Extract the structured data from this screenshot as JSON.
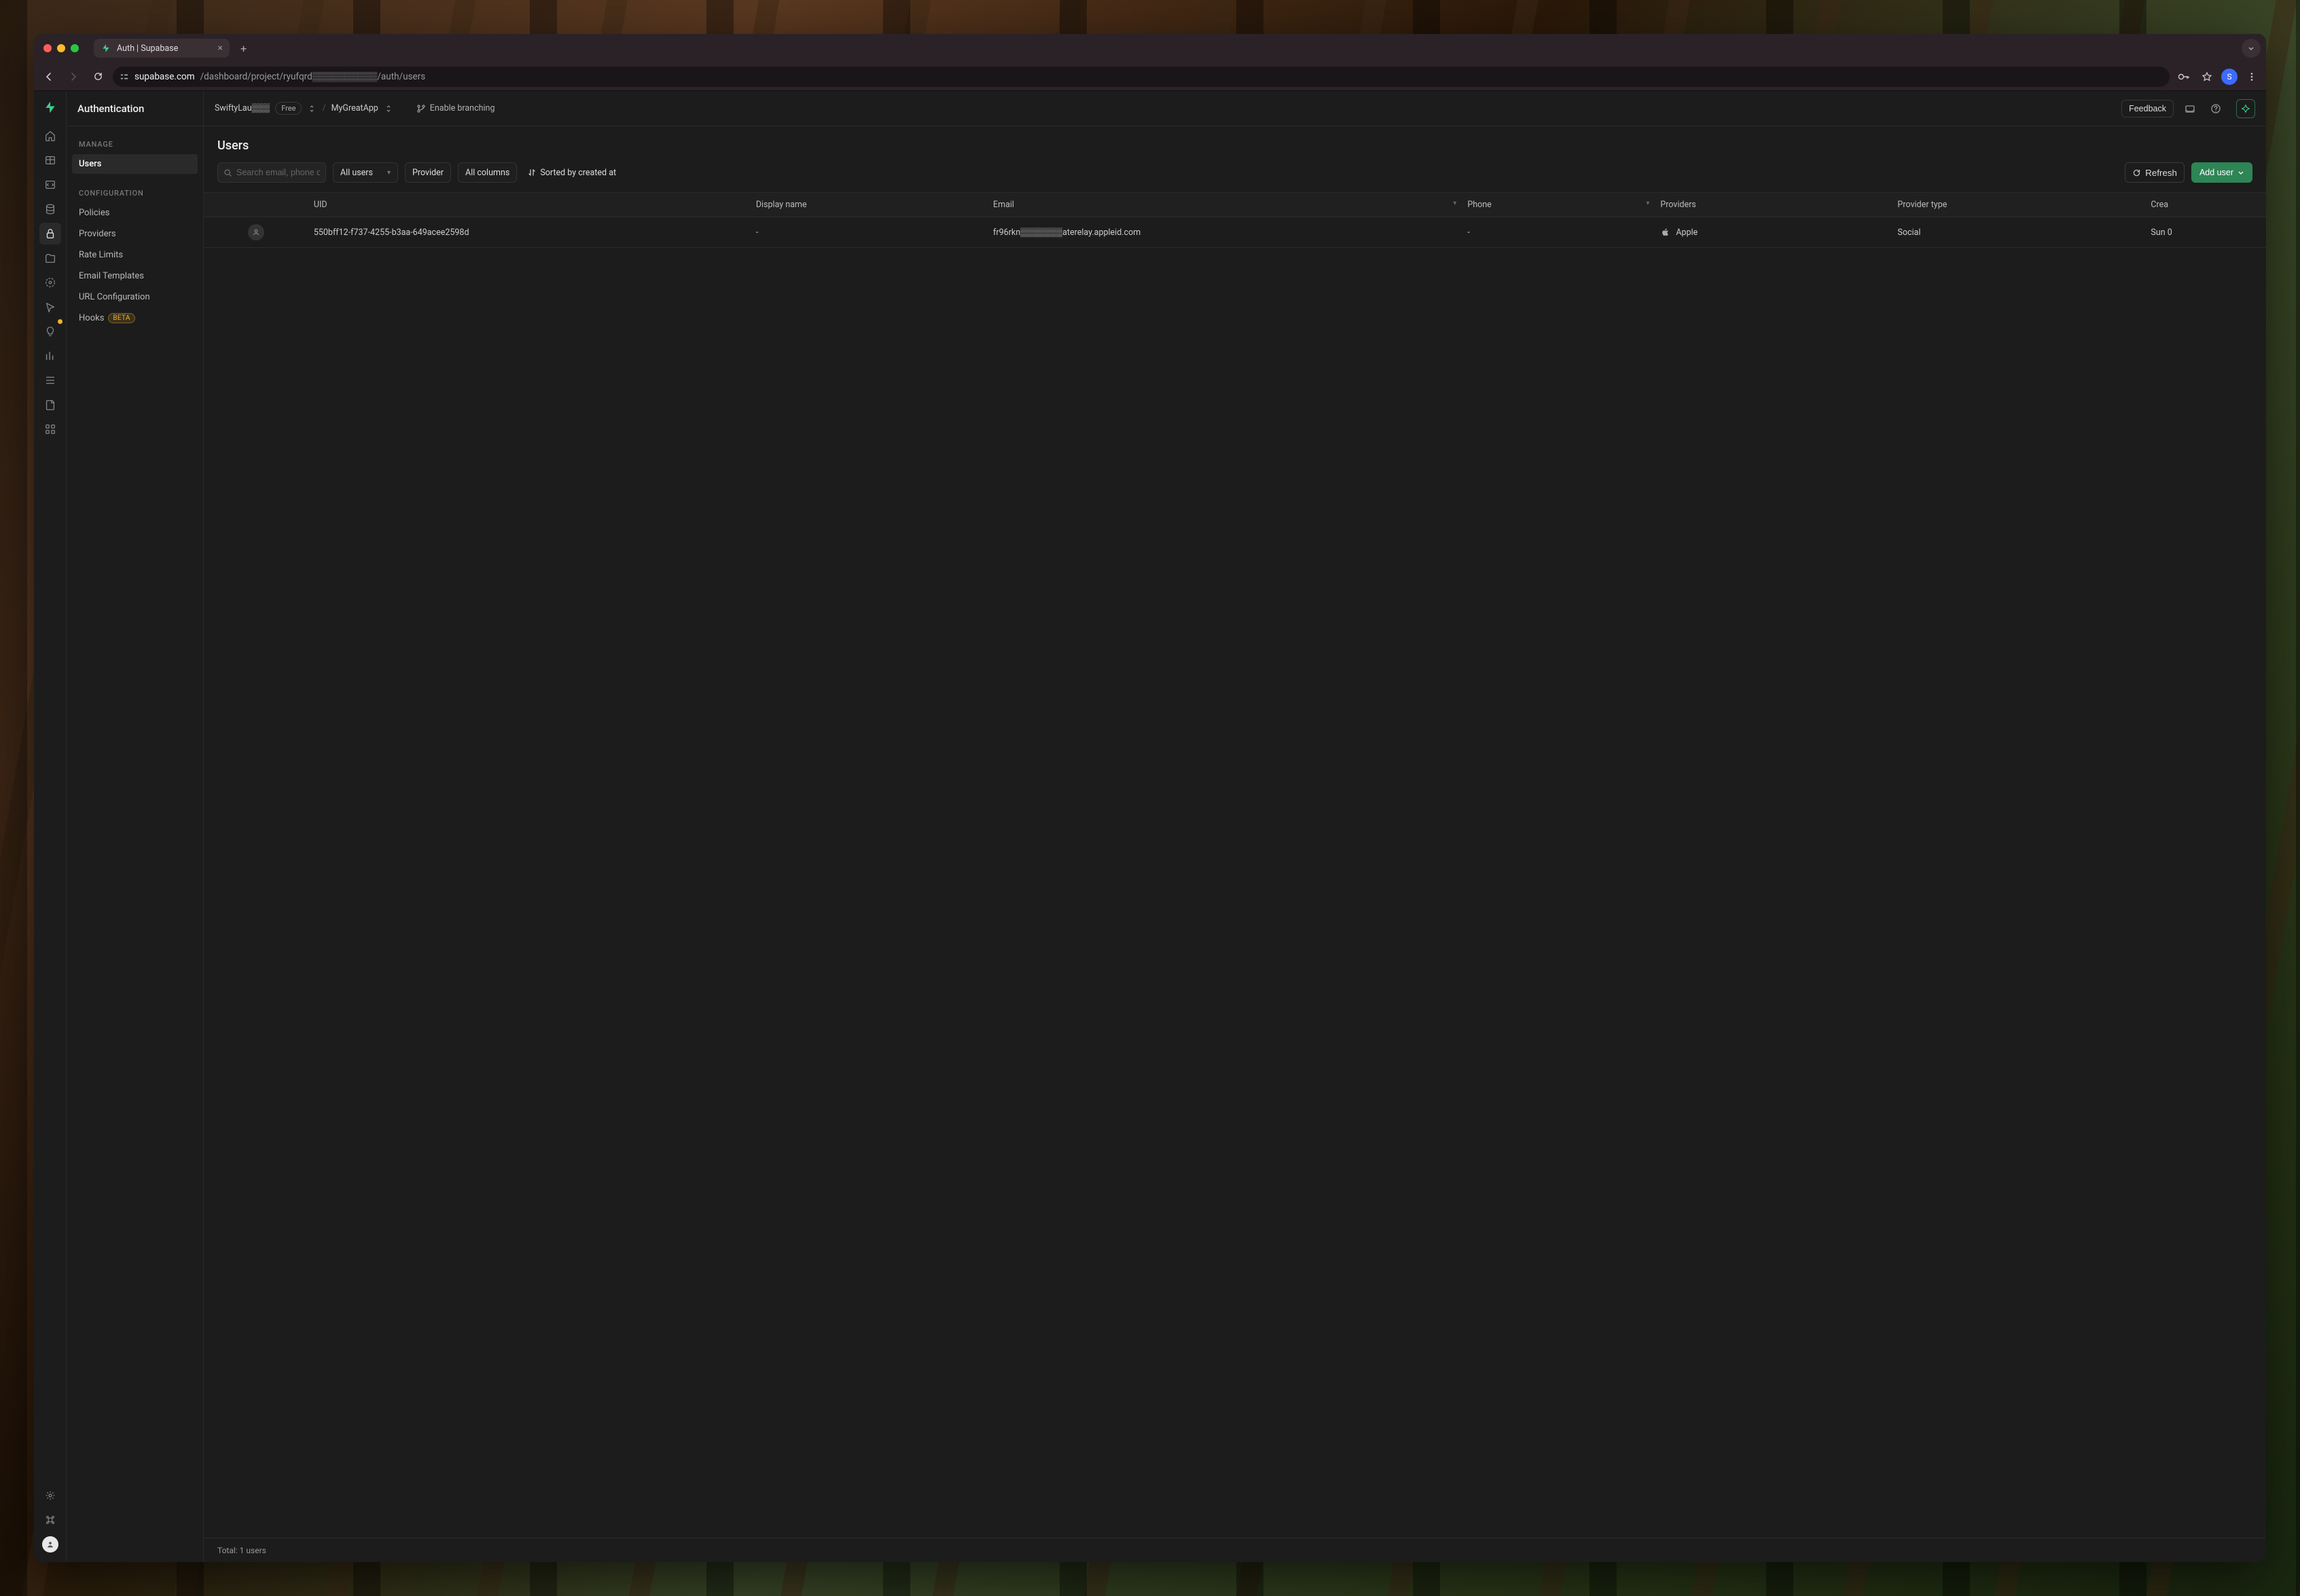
{
  "browser": {
    "tab_title": "Auth | Supabase",
    "url_display_host": "supabase.com",
    "url_display_path": "/dashboard/project/ryufqrd▒▒▒▒▒▒▒▒▒▒/auth/users",
    "profile_initial": "S"
  },
  "sidebar": {
    "title": "Authentication",
    "sections": [
      {
        "label": "MANAGE",
        "items": [
          {
            "label": "Users",
            "active": true
          }
        ]
      },
      {
        "label": "CONFIGURATION",
        "items": [
          {
            "label": "Policies"
          },
          {
            "label": "Providers"
          },
          {
            "label": "Rate Limits"
          },
          {
            "label": "Email Templates"
          },
          {
            "label": "URL Configuration"
          },
          {
            "label": "Hooks",
            "badge": "BETA"
          }
        ]
      }
    ]
  },
  "topbar": {
    "org": "SwiftyLau▒▒▒",
    "plan": "Free",
    "project": "MyGreatApp",
    "branching_label": "Enable branching",
    "feedback_label": "Feedback"
  },
  "page": {
    "title": "Users",
    "search_placeholder": "Search email, phone or UID",
    "filters": {
      "users": "All users",
      "provider": "Provider",
      "columns": "All columns",
      "sort": "Sorted by created at"
    },
    "refresh_label": "Refresh",
    "add_user_label": "Add user",
    "columns": {
      "uid": "UID",
      "display_name": "Display name",
      "email": "Email",
      "phone": "Phone",
      "providers": "Providers",
      "provider_type": "Provider type",
      "created": "Crea"
    },
    "rows": [
      {
        "uid": "550bff12-f737-4255-b3aa-649acee2598d",
        "display_name": "-",
        "email": "fr96rkn▒▒▒▒▒▒▒aterelay.appleid.com",
        "phone": "-",
        "provider": "Apple",
        "provider_type": "Social",
        "created": "Sun 0"
      }
    ],
    "footer_total": "Total: 1 users"
  }
}
